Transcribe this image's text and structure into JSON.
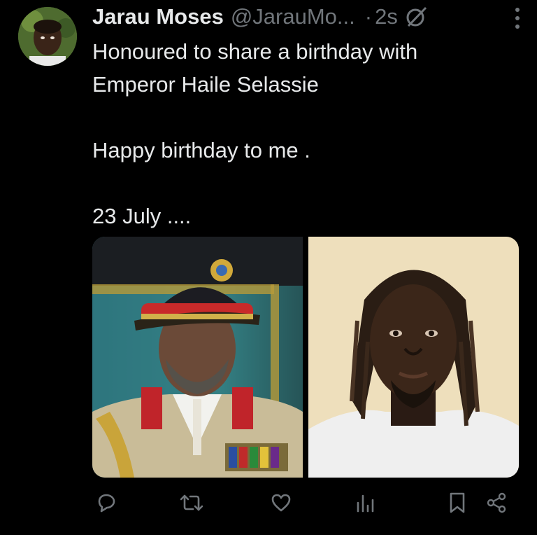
{
  "tweet": {
    "author_name": "Jarau Moses",
    "author_handle": "@JarauMo...",
    "dot": "·",
    "time": "2s",
    "lines": [
      "Honoured to share a birthday with",
      "Emperor Haile Selassie",
      "",
      "Happy birthday to me .",
      "",
      "23 July ...."
    ]
  },
  "media": {
    "left_image": "haile-selassie-portrait",
    "right_image": "author-portrait"
  },
  "actions": [
    "reply-icon",
    "retweet-icon",
    "like-icon",
    "views-icon",
    "bookmark-icon",
    "share-icon"
  ],
  "colors": {
    "background": "#000000",
    "text": "#e7e9ea",
    "secondary": "#71767b"
  }
}
